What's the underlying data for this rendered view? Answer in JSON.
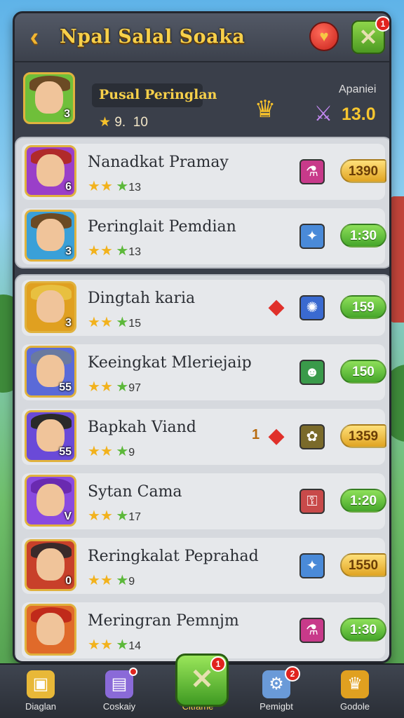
{
  "header": {
    "title": "Npal Salal Soaka",
    "back_icon": "chevron-left-icon",
    "heart_icon": "heart-icon",
    "close_icon": "close-icon",
    "close_badge": "1"
  },
  "me": {
    "name": "Pusal Peringlan",
    "score_star": "9.",
    "score_value": "10",
    "level": "3",
    "label": "Apaniei",
    "value": "13.0"
  },
  "players": [
    {
      "name": "Nanadkat Pramay",
      "meta": "13",
      "level": "6",
      "value": "1390",
      "pill": "gold",
      "icon": "potion-icon"
    },
    {
      "name": "Peringlait Pemdian",
      "meta": "13",
      "level": "3",
      "value": "1:30",
      "pill": "green",
      "icon": "shield-icon"
    },
    {
      "name": "Dingtah karia",
      "meta": "15",
      "level": "3",
      "value": "159",
      "pill": "green",
      "icon": "dragon-icon"
    },
    {
      "name": "Keeingkat Mleriejaip",
      "meta": "97",
      "level": "55",
      "value": "150",
      "pill": "green",
      "icon": "mask-icon"
    },
    {
      "name": "Bapkah Viand",
      "meta": "9",
      "level": "55",
      "value": "1359",
      "pill": "gold",
      "icon": "beast-icon",
      "badge": "1"
    },
    {
      "name": "Sytan Cama",
      "meta": "17",
      "level": "V",
      "value": "1:20",
      "pill": "green",
      "icon": "key-icon"
    },
    {
      "name": "Reringkalat Peprahad",
      "meta": "9",
      "level": "0",
      "value": "1550",
      "pill": "gold",
      "icon": "shield-icon"
    },
    {
      "name": "Meringran Pemnjm",
      "meta": "14",
      "level": "",
      "value": "1:30",
      "pill": "green",
      "icon": "potion-icon"
    }
  ],
  "nav": [
    {
      "label": "Diaglan",
      "icon": "chest-icon"
    },
    {
      "label": "Coskaiy",
      "icon": "book-icon",
      "badge": ""
    },
    {
      "label": "Citfame",
      "icon": "close-icon",
      "badge": "1"
    },
    {
      "label": "Pemigbt",
      "icon": "gear-icon",
      "badge": "2"
    },
    {
      "label": "Godole",
      "icon": "trophy-icon"
    }
  ]
}
